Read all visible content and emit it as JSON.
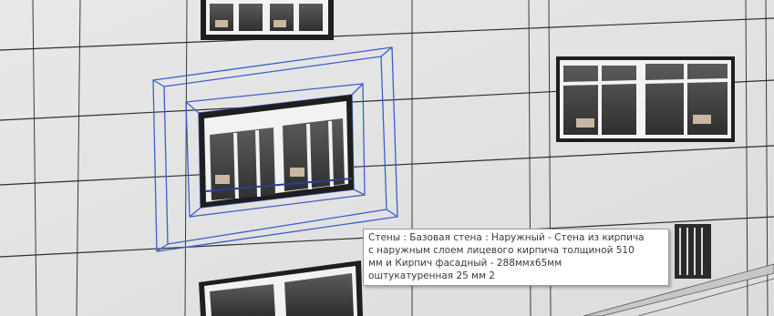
{
  "viewport": {
    "name": "3d-model-view",
    "description_colors": {
      "wall": "#e3e3e3",
      "grid_lines": "#2b2b2b",
      "selection": "#3b5fc8",
      "window_frame": "#f4f4f4",
      "glass": "#3a3a3a"
    }
  },
  "tooltip": {
    "lines": [
      "Стены : Базовая стена : Наружный - Стена из кирпича",
      "с наружным слоем лицевого кирпича толщиной 510",
      "мм и Кирпич фасадный - 288ммх65мм",
      "оштукатуренная 25 мм 2"
    ]
  }
}
